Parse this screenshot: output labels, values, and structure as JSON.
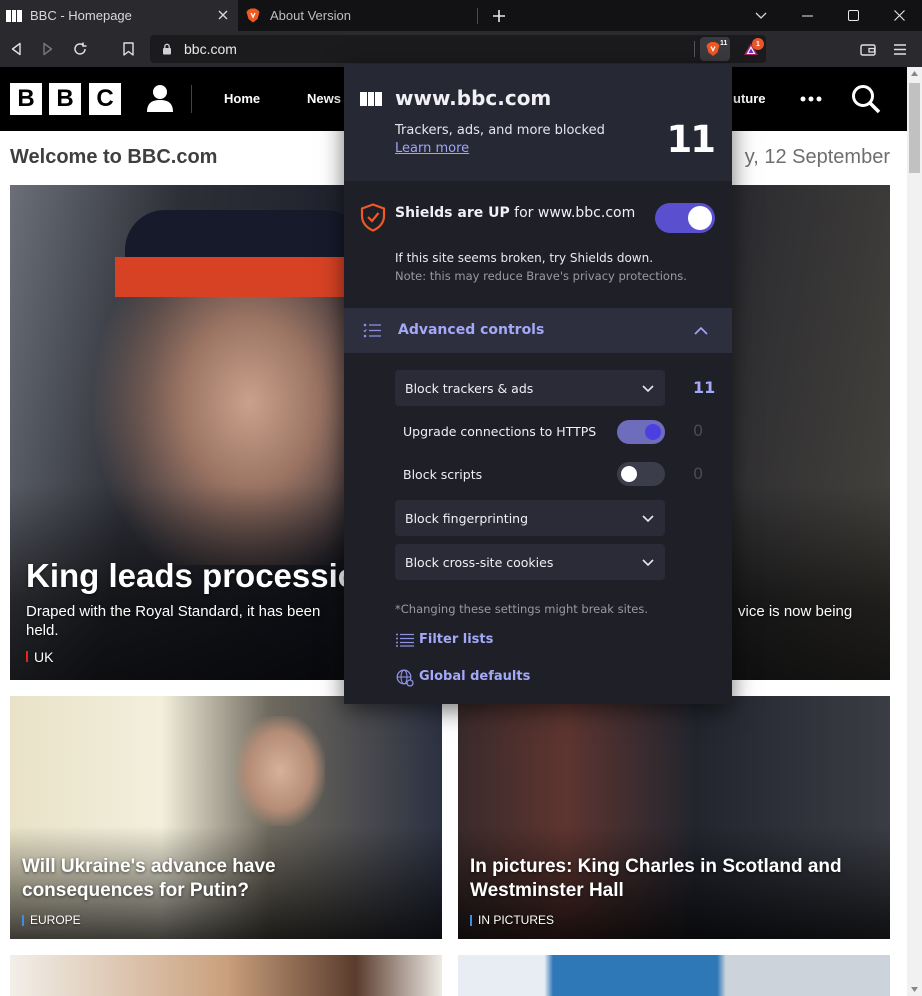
{
  "browser": {
    "tabs": [
      {
        "title": "BBC - Homepage",
        "active": true
      },
      {
        "title": "About Version",
        "active": false
      }
    ],
    "url": "bbc.com",
    "shields_badge_count": "11",
    "rewards_badge_count": "1"
  },
  "bbc": {
    "nav": [
      "Home",
      "News"
    ],
    "nav_partial": "uture",
    "welcome": "Welcome to BBC.com",
    "date": "y, 12 September",
    "stories": [
      {
        "headline": "King leads processio",
        "summary": "Draped with the Royal Standard, it has been",
        "summary2": "held.",
        "summary_right": "vice is now being",
        "tag": "UK",
        "tag_color": "#e4251b"
      },
      {
        "headline": "Will Ukraine's advance have consequences for Putin?",
        "tag": "EUROPE",
        "tag_color": "#3b8ee6"
      },
      {
        "headline": "In pictures: King Charles in Scotland and Westminster Hall",
        "tag": "IN PICTURES",
        "tag_color": "#3b8ee6"
      }
    ]
  },
  "shields": {
    "site": "www.bbc.com",
    "blocked_text": "Trackers, ads, and more blocked",
    "learn_more": "Learn more",
    "blocked_count": "11",
    "status_bold": "Shields are UP",
    "status_rest": " for www.bbc.com",
    "shields_on": true,
    "broken_text": "If this site seems broken, try Shields down.",
    "note_text": "Note: this may reduce Brave's privacy protections.",
    "advanced_label": "Advanced controls",
    "controls": {
      "trackers": {
        "label": "Block trackers & ads",
        "count": "11"
      },
      "https": {
        "label": "Upgrade connections to HTTPS",
        "count": "0",
        "enabled": true
      },
      "scripts": {
        "label": "Block scripts",
        "count": "0",
        "enabled": false
      },
      "fingerprinting": {
        "label": "Block fingerprinting"
      },
      "cookies": {
        "label": "Block cross-site cookies"
      }
    },
    "warning": "*Changing these settings might break sites.",
    "filter_lists": "Filter lists",
    "global_defaults": "Global defaults"
  },
  "colors": {
    "accent": "#5a4fcf",
    "link": "#a4a8f8",
    "brave_orange": "#f05a22"
  }
}
